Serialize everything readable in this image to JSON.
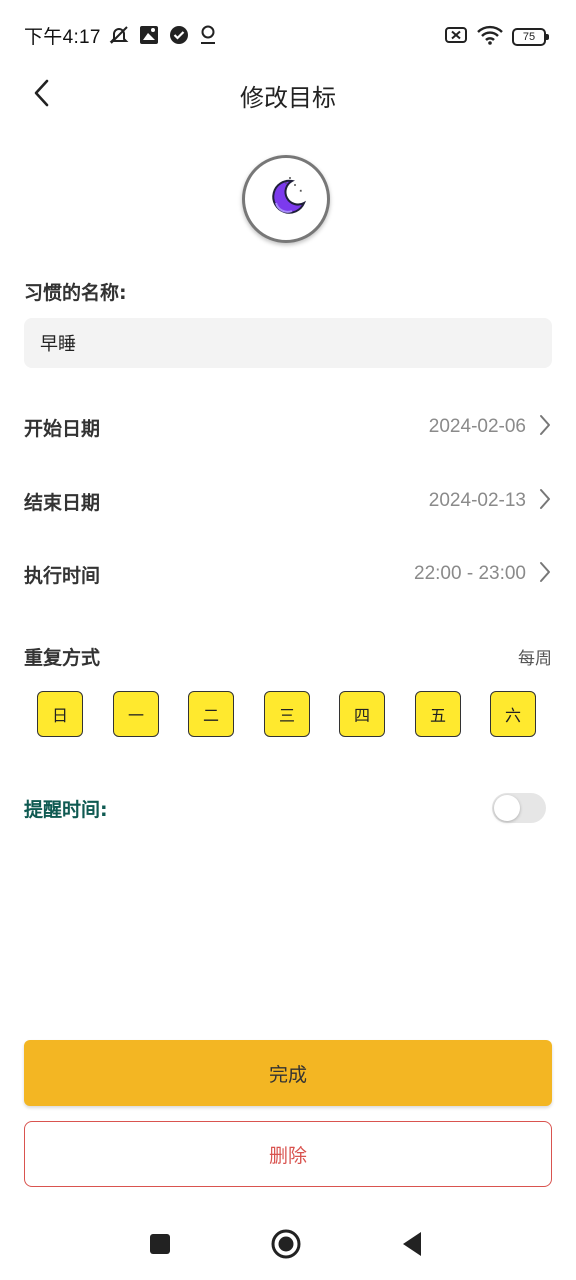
{
  "status_bar": {
    "time": "下午4:17",
    "battery": "75",
    "left_icons": [
      "mute-bell-icon",
      "image-icon",
      "check-circle-icon",
      "location-icon"
    ],
    "right_icons": [
      "sim-x-icon",
      "wifi-icon",
      "battery-icon"
    ]
  },
  "header": {
    "title": "修改目标",
    "back_icon": "chevron-left-icon"
  },
  "avatar": {
    "icon": "moon-icon",
    "accent": "#7c3aed"
  },
  "habit": {
    "label": "习惯的名称:",
    "value": "早睡"
  },
  "rows": {
    "start_date": {
      "label": "开始日期",
      "value": "2024-02-06"
    },
    "end_date": {
      "label": "结束日期",
      "value": "2024-02-13"
    },
    "exec_time": {
      "label": "执行时间",
      "value": "22:00 - 23:00"
    }
  },
  "repeat": {
    "label": "重复方式",
    "mode": "每周",
    "days": [
      "日",
      "一",
      "二",
      "三",
      "四",
      "五",
      "六"
    ],
    "day_color": "#ffe92e"
  },
  "reminder": {
    "label": "提醒时间:",
    "color": "#0f5a52",
    "enabled": false
  },
  "buttons": {
    "done": "完成",
    "done_color": "#f3b623",
    "delete": "删除",
    "delete_color": "#d9534f"
  },
  "nav": {
    "icons": [
      "square-icon",
      "home-circle-icon",
      "back-triangle-icon"
    ]
  }
}
